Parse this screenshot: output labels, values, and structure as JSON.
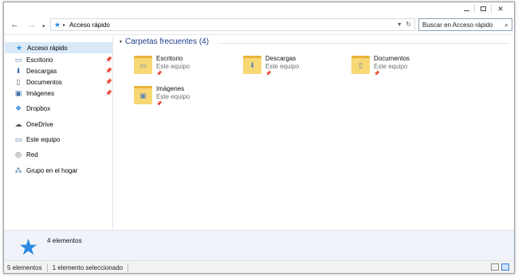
{
  "window": {
    "controls": {
      "minimize": "—",
      "maximize": "□",
      "close": "✕"
    }
  },
  "navigation": {
    "back_icon": "←",
    "forward_icon": "→",
    "recent_icon": "▾"
  },
  "address": {
    "star_icon": "★",
    "chevron": "▸",
    "path": "Acceso rápido",
    "dropdown_icon": "▾",
    "refresh_icon": "↻"
  },
  "search": {
    "placeholder": "Buscar en Acceso rápido",
    "icon": "⌕"
  },
  "sidebar": {
    "quick_access": {
      "label": "Acceso rápido",
      "icon": "★"
    },
    "pinned": [
      {
        "label": "Escritorio",
        "icon": "▭"
      },
      {
        "label": "Descargas",
        "icon": "⬇"
      },
      {
        "label": "Documentos",
        "icon": "▯"
      },
      {
        "label": "Imágenes",
        "icon": "▣"
      }
    ],
    "pin_icon": "📌",
    "others": [
      {
        "label": "Dropbox",
        "icon": "❖"
      },
      {
        "label": "OneDrive",
        "icon": "☁"
      },
      {
        "label": "Este equipo",
        "icon": "▭"
      },
      {
        "label": "Red",
        "icon": "◎"
      },
      {
        "label": "Grupo en el hogar",
        "icon": "⁂"
      }
    ]
  },
  "content": {
    "group_title": "Carpetas frecuentes (4)",
    "group_chevron": "▾",
    "folders": [
      {
        "name": "Escritorio",
        "location": "Este equipo",
        "glyph": "▭"
      },
      {
        "name": "Descargas",
        "location": "Este equipo",
        "glyph": "⬇"
      },
      {
        "name": "Documentos",
        "location": "Este equipo",
        "glyph": "▯"
      },
      {
        "name": "Imágenes",
        "location": "Este equipo",
        "glyph": "▣"
      }
    ],
    "pin_icon": "📌"
  },
  "details_pane": {
    "icon": "★",
    "count": "4 elementos"
  },
  "statusbar": {
    "items_count": "5 elementos",
    "selection": "1 elemento seleccionado"
  },
  "colors": {
    "accent": "#2a8ae0",
    "group_title": "#1e3c8c",
    "selection": "#d9e9f8",
    "folder": "#f8d775"
  }
}
